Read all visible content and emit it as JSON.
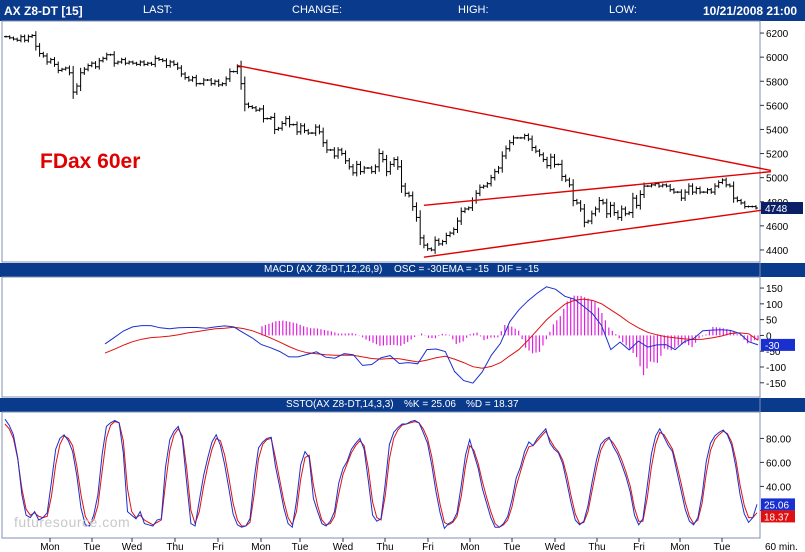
{
  "header": {
    "symbol": "AX Z8-DT [15]",
    "last_label": "LAST:",
    "change_label": "CHANGE:",
    "high_label": "HIGH:",
    "low_label": "LOW:",
    "datetime": "10/21/2008 21:00"
  },
  "annotation": "FDax 60er",
  "watermark": "futuresource.com",
  "colors": {
    "bar_bg": "#0a3a8c",
    "trend": "#e00000",
    "macd": "#1a2fd0",
    "ema": "#e01010",
    "dif": "#e020e0"
  },
  "chart_data": [
    {
      "type": "bar",
      "title": "AX Z8-DT [15]",
      "y_ticks": [
        6200,
        6000,
        5800,
        5600,
        5400,
        5200,
        5000,
        4800,
        4600,
        4400
      ],
      "ylim": [
        4300,
        6300
      ],
      "last_value_label": "4748",
      "close_series": [
        6170,
        6160,
        6150,
        6140,
        6170,
        6140,
        6170,
        6180,
        6090,
        6030,
        6010,
        5960,
        5980,
        5940,
        5890,
        5900,
        5910,
        5870,
        5710,
        5760,
        5870,
        5900,
        5930,
        5950,
        5920,
        5970,
        5990,
        6020,
        6020,
        5950,
        5960,
        5980,
        5950,
        5960,
        5950,
        5940,
        5960,
        5940,
        5950,
        5940,
        5990,
        5980,
        5970,
        5930,
        5960,
        5940,
        5910,
        5860,
        5830,
        5810,
        5830,
        5780,
        5780,
        5810,
        5810,
        5780,
        5800,
        5770,
        5780,
        5820,
        5880,
        5880,
        5920,
        5780,
        5610,
        5590,
        5580,
        5560,
        5570,
        5490,
        5490,
        5500,
        5400,
        5410,
        5450,
        5490,
        5440,
        5440,
        5380,
        5430,
        5390,
        5370,
        5370,
        5420,
        5380,
        5290,
        5230,
        5230,
        5180,
        5230,
        5200,
        5140,
        5090,
        5040,
        5110,
        5050,
        5080,
        5080,
        5050,
        5090,
        5200,
        5150,
        5050,
        5110,
        5150,
        5090,
        4930,
        4870,
        4850,
        4760,
        4670,
        4500,
        4440,
        4410,
        4400,
        4480,
        4450,
        4470,
        4520,
        4540,
        4570,
        4640,
        4720,
        4740,
        4750,
        4810,
        4870,
        4920,
        4930,
        4950,
        5000,
        5050,
        5080,
        5180,
        5240,
        5290,
        5330,
        5330,
        5330,
        5350,
        5320,
        5250,
        5220,
        5190,
        5150,
        5100,
        5170,
        5110,
        5110,
        5010,
        4980,
        4940,
        4810,
        4790,
        4740,
        4630,
        4640,
        4700,
        4740,
        4810,
        4790,
        4700,
        4770,
        4710,
        4670,
        4740,
        4700,
        4710,
        4830,
        4770,
        4860,
        4930,
        4930,
        4940,
        4950,
        4930,
        4940,
        4930,
        4900,
        4880,
        4880,
        4830,
        4880,
        4930,
        4880,
        4910,
        4880,
        4880,
        4900,
        4880,
        4930,
        4960,
        4980,
        4940,
        4930,
        4830,
        4810,
        4790,
        4760,
        4760,
        4760,
        4748
      ],
      "trendlines": [
        {
          "from": {
            "index": 62,
            "price": 5930
          },
          "to": {
            "index": 205,
            "price": 5060
          }
        },
        {
          "from": {
            "index": 112,
            "price": 4770
          },
          "to": {
            "index": 205,
            "price": 5050
          }
        },
        {
          "from": {
            "index": 112,
            "price": 4340
          },
          "to": {
            "index": 205,
            "price": 4740
          }
        }
      ]
    },
    {
      "type": "line",
      "title": "MACD (AX Z8-DT,12,26,9)",
      "legend": [
        {
          "text": "OSC = -30",
          "color": "#1a2fd0"
        },
        {
          "text": "EMA = -15",
          "color": "#e01010"
        },
        {
          "text": "DIF = -15",
          "color": "#e020e0"
        }
      ],
      "y_ticks": [
        150,
        100,
        50,
        0,
        -50,
        -100,
        -150
      ],
      "ylim": [
        -195,
        185
      ],
      "last_value_label": "-30",
      "series": [
        {
          "values": [
            -27,
            -7,
            14,
            27,
            31,
            31,
            24,
            21,
            24,
            25,
            25,
            23,
            27,
            30,
            27,
            9,
            -8,
            -29,
            -39,
            -51,
            -68,
            -68,
            -60,
            -52,
            -69,
            -72,
            -58,
            -61,
            -95,
            -92,
            -71,
            -64,
            -89,
            -86,
            -90,
            -45,
            -43,
            -51,
            -114,
            -143,
            -151,
            -116,
            -63,
            -25,
            43,
            81,
            110,
            134,
            154,
            146,
            124,
            115,
            93,
            69,
            31,
            -45,
            -21,
            -46,
            -18,
            -37,
            -30,
            -29,
            -45,
            -20,
            -10,
            15,
            17,
            18,
            16,
            6,
            -20,
            -30
          ]
        },
        {
          "values": [
            -56,
            -44,
            -31,
            -20,
            -12,
            -7,
            -5,
            -2,
            2,
            8,
            12,
            17,
            21,
            23,
            26,
            22,
            15,
            4,
            -8,
            -21,
            -35,
            -47,
            -55,
            -58,
            -61,
            -63,
            -63,
            -63,
            -68,
            -73,
            -75,
            -73,
            -74,
            -79,
            -84,
            -78,
            -71,
            -66,
            -75,
            -86,
            -99,
            -104,
            -98,
            -86,
            -65,
            -45,
            -15,
            17,
            49,
            75,
            99,
            111,
            115,
            111,
            100,
            81,
            62,
            41,
            24,
            10,
            2,
            -4,
            -8,
            -11,
            -13,
            -12,
            -8,
            -2,
            6,
            8,
            5,
            -15
          ]
        },
        {
          "values": [
            29,
            37,
            45,
            47,
            43,
            38,
            29,
            23,
            22,
            17,
            13,
            6,
            6,
            7,
            1,
            -13,
            -23,
            -33,
            -31,
            -30,
            -33,
            -21,
            -5,
            6,
            -8,
            -9,
            5,
            2,
            -27,
            -19,
            4,
            9,
            -15,
            -7,
            -6,
            33,
            28,
            15,
            -39,
            -57,
            -52,
            -12,
            35,
            61,
            108,
            126,
            125,
            117,
            105,
            71,
            25,
            4,
            -22,
            -42,
            -69,
            -126,
            -83,
            -87,
            -42,
            -47,
            -32,
            -25,
            -37,
            -9,
            3,
            27,
            25,
            20,
            10,
            -2,
            -25,
            -15
          ]
        }
      ]
    },
    {
      "type": "line",
      "title": "SSTO(AX Z8-DT,14,3,3)",
      "legend": [
        {
          "text": "%K = 25.06",
          "color": "#1a2fd0"
        },
        {
          "text": "%D = 18.37",
          "color": "#e01010"
        }
      ],
      "y_ticks": [
        80,
        60,
        40,
        20
      ],
      "ylim": [
        -3,
        102
      ],
      "last_value_labels": [
        "25.06",
        "18.37"
      ],
      "series": [
        {
          "values": [
            96,
            91,
            83,
            64,
            33,
            16,
            14,
            19,
            12,
            14,
            18,
            44,
            71,
            80,
            83,
            78,
            69,
            49,
            22,
            8,
            7,
            16,
            33,
            67,
            90,
            93,
            95,
            93,
            68,
            19,
            16,
            13,
            19,
            9,
            8,
            7,
            12,
            13,
            56,
            79,
            86,
            90,
            79,
            43,
            9,
            7,
            28,
            49,
            64,
            77,
            83,
            74,
            58,
            38,
            17,
            8,
            6,
            7,
            13,
            47,
            72,
            77,
            80,
            81,
            57,
            40,
            22,
            9,
            6,
            28,
            58,
            69,
            64,
            30,
            19,
            9,
            7,
            11,
            19,
            43,
            55,
            61,
            71,
            76,
            80,
            71,
            45,
            16,
            11,
            13,
            42,
            75,
            85,
            89,
            92,
            92,
            94,
            95,
            93,
            85,
            76,
            58,
            36,
            18,
            5,
            9,
            11,
            18,
            41,
            66,
            79,
            67,
            55,
            38,
            26,
            14,
            6,
            6,
            9,
            15,
            29,
            47,
            56,
            69,
            77,
            74,
            80,
            84,
            88,
            76,
            71,
            68,
            59,
            43,
            26,
            12,
            8,
            11,
            24,
            44,
            62,
            75,
            79,
            81,
            73,
            67,
            58,
            48,
            35,
            16,
            8,
            13,
            40,
            67,
            82,
            88,
            81,
            74,
            69,
            53,
            37,
            21,
            11,
            8,
            14,
            33,
            61,
            76,
            82,
            85,
            87,
            83,
            74,
            56,
            33,
            17,
            10,
            14,
            25
          ]
        },
        {
          "values": [
            92,
            88,
            80,
            63,
            38,
            21,
            16,
            18,
            15,
            14,
            15,
            32,
            58,
            75,
            82,
            80,
            74,
            57,
            33,
            15,
            9,
            12,
            24,
            53,
            80,
            91,
            94,
            93,
            78,
            38,
            19,
            14,
            16,
            12,
            10,
            8,
            10,
            12,
            42,
            70,
            83,
            88,
            82,
            55,
            20,
            9,
            19,
            40,
            57,
            71,
            80,
            78,
            66,
            47,
            26,
            12,
            7,
            7,
            10,
            34,
            63,
            75,
            79,
            80,
            64,
            46,
            28,
            14,
            8,
            19,
            46,
            64,
            66,
            41,
            24,
            12,
            8,
            9,
            15,
            34,
            50,
            59,
            68,
            74,
            78,
            74,
            55,
            27,
            14,
            12,
            32,
            63,
            80,
            87,
            91,
            92,
            93,
            94,
            93,
            88,
            80,
            65,
            44,
            25,
            10,
            8,
            10,
            15,
            32,
            57,
            74,
            70,
            59,
            44,
            31,
            19,
            9,
            6,
            8,
            12,
            23,
            40,
            52,
            64,
            73,
            74,
            78,
            82,
            86,
            79,
            73,
            69,
            62,
            49,
            32,
            17,
            9,
            10,
            19,
            37,
            55,
            70,
            77,
            80,
            76,
            70,
            62,
            52,
            40,
            22,
            11,
            11,
            30,
            56,
            75,
            85,
            83,
            77,
            71,
            58,
            43,
            27,
            15,
            9,
            12,
            26,
            51,
            70,
            79,
            83,
            86,
            84,
            77,
            62,
            41,
            24,
            14,
            14,
            18
          ]
        }
      ]
    }
  ],
  "x_labels": [
    "Mon",
    "Tue",
    "Wed",
    "Thu",
    "Fri",
    "Mon",
    "Tue",
    "Wed",
    "Thu",
    "Fri",
    "Mon",
    "Tue",
    "Wed",
    "Thu",
    "Fri",
    "Mon",
    "Tue"
  ],
  "x_unit": "60 min."
}
